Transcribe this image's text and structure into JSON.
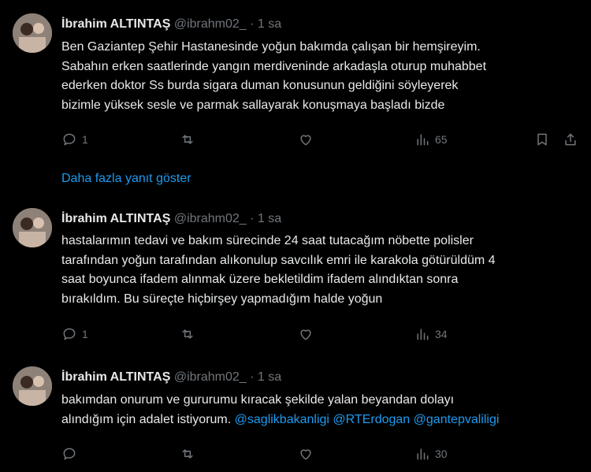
{
  "colors": {
    "background": "#000000",
    "text": "#e7e9ea",
    "muted": "#71767b",
    "link": "#1d9bf0"
  },
  "tweets": [
    {
      "name": "İbrahim ALTINTAŞ",
      "handle": "@ibrahm02_",
      "dot": "·",
      "time": "1 sa",
      "lines": [
        "Ben Gaziantep Şehir Hastanesinde yoğun bakımda çalışan bir hemşireyim.",
        "Sabahın erken saatlerinde yangın merdiveninde arkadaşla oturup muhabbet",
        "ederken doktor Ss burda sigara duman konusunun geldiğini söyleyerek",
        "bizimle yüksek sesle ve parmak sallayarak konuşmaya başladı bizde"
      ],
      "replies": "1",
      "retweets": "",
      "likes": "",
      "views": "65"
    },
    {
      "name": "İbrahim ALTINTAŞ",
      "handle": "@ibrahm02_",
      "dot": "·",
      "time": "1 sa",
      "lines": [
        "hastalarımın tedavi ve bakım sürecinde 24 saat tutacağım nöbette polisler",
        "tarafından yoğun tarafından alıkonulup savcılık emri ile karakola götürüldüm 4",
        "saat boyunca ifadem alınmak üzere bekletildim ifadem alındıktan sonra",
        "bırakıldım. Bu süreçte hiçbirşey yapmadığım halde yoğun"
      ],
      "replies": "1",
      "retweets": "",
      "likes": "",
      "views": "34"
    },
    {
      "name": "İbrahim ALTINTAŞ",
      "handle": "@ibrahm02_",
      "dot": "·",
      "time": "1 sa",
      "lines": [
        "bakımdan onurum ve gururumu kıracak şekilde yalan beyandan dolayı"
      ],
      "last_line_text": "alındığım için adalet istiyorum.",
      "mentions": [
        "@saglikbakanligi",
        "@RTErdogan",
        "@gantepvaliligi"
      ],
      "replies": "",
      "retweets": "",
      "likes": "",
      "views": "30"
    }
  ],
  "show_more": "Daha fazla yanıt göster",
  "icons": [
    "reply-icon",
    "retweet-icon",
    "like-icon",
    "views-icon",
    "bookmark-icon",
    "share-icon"
  ]
}
